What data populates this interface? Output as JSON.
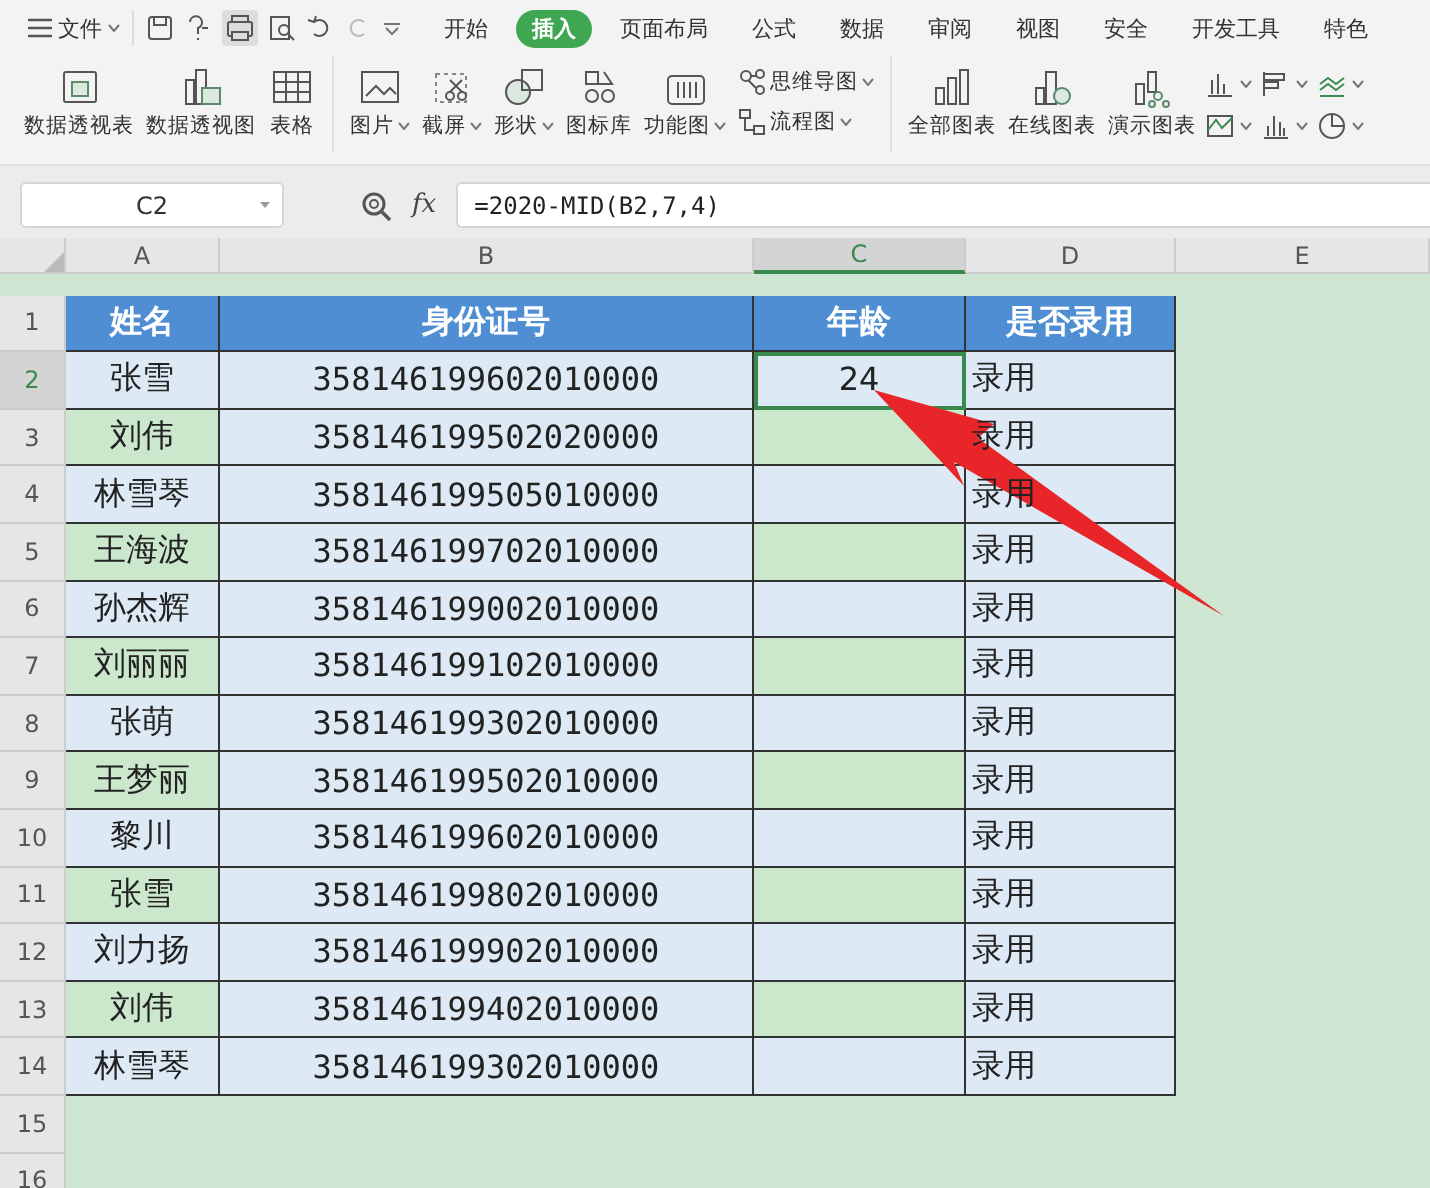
{
  "menu": {
    "file_label": "文件",
    "tabs": [
      {
        "label": "开始",
        "selected": false
      },
      {
        "label": "插入",
        "selected": true
      },
      {
        "label": "页面布局",
        "selected": false
      },
      {
        "label": "公式",
        "selected": false
      },
      {
        "label": "数据",
        "selected": false
      },
      {
        "label": "审阅",
        "selected": false
      },
      {
        "label": "视图",
        "selected": false
      },
      {
        "label": "安全",
        "selected": false
      },
      {
        "label": "开发工具",
        "selected": false
      },
      {
        "label": "特色",
        "selected": false
      }
    ]
  },
  "ribbon": {
    "groups": [
      [
        {
          "kind": "large",
          "label": "数据透视表",
          "dropdown": false
        },
        {
          "kind": "large",
          "label": "数据透视图",
          "dropdown": false
        },
        {
          "kind": "large",
          "label": "表格",
          "dropdown": false
        }
      ],
      [
        {
          "kind": "large",
          "label": "图片",
          "dropdown": true
        },
        {
          "kind": "large",
          "label": "截屏",
          "dropdown": true
        },
        {
          "kind": "large",
          "label": "形状",
          "dropdown": true
        },
        {
          "kind": "large",
          "label": "图标库",
          "dropdown": false
        },
        {
          "kind": "large",
          "label": "功能图",
          "dropdown": true
        },
        {
          "kind": "small",
          "label": "思维导图",
          "dropdown": true
        },
        {
          "kind": "small",
          "label": "流程图",
          "dropdown": true
        }
      ],
      [
        {
          "kind": "large",
          "label": "全部图表",
          "dropdown": false
        },
        {
          "kind": "large",
          "label": "在线图表",
          "dropdown": false
        },
        {
          "kind": "large",
          "label": "演示图表",
          "dropdown": false
        },
        {
          "kind": "mini",
          "dropdown": true
        },
        {
          "kind": "mini",
          "dropdown": true
        },
        {
          "kind": "mini",
          "dropdown": true
        },
        {
          "kind": "mini",
          "dropdown": true
        },
        {
          "kind": "mini",
          "dropdown": true
        },
        {
          "kind": "mini",
          "dropdown": true
        }
      ]
    ]
  },
  "formula_bar": {
    "name_box": "C2",
    "fx": "fx",
    "formula": "=2020-MID(B2,7,4)"
  },
  "sheet": {
    "columns": [
      {
        "label": "A",
        "selected": false
      },
      {
        "label": "B",
        "selected": false
      },
      {
        "label": "C",
        "selected": true
      },
      {
        "label": "D",
        "selected": false
      },
      {
        "label": "E",
        "selected": false
      }
    ],
    "rows": [
      {
        "number": "1",
        "selected": false,
        "header": true,
        "cells": [
          "姓名",
          "身份证号",
          "年龄",
          "是否录用"
        ]
      },
      {
        "number": "2",
        "selected": true,
        "header": false,
        "cells": [
          "张雪",
          "358146199602010000",
          "24",
          "录用"
        ]
      },
      {
        "number": "3",
        "selected": false,
        "header": false,
        "cells": [
          "刘伟",
          "358146199502020000",
          "",
          "录用"
        ]
      },
      {
        "number": "4",
        "selected": false,
        "header": false,
        "cells": [
          "林雪琴",
          "358146199505010000",
          "",
          "录用"
        ]
      },
      {
        "number": "5",
        "selected": false,
        "header": false,
        "cells": [
          "王海波",
          "358146199702010000",
          "",
          "录用"
        ]
      },
      {
        "number": "6",
        "selected": false,
        "header": false,
        "cells": [
          "孙杰辉",
          "358146199002010000",
          "",
          "录用"
        ]
      },
      {
        "number": "7",
        "selected": false,
        "header": false,
        "cells": [
          "刘丽丽",
          "358146199102010000",
          "",
          "录用"
        ]
      },
      {
        "number": "8",
        "selected": false,
        "header": false,
        "cells": [
          "张萌",
          "358146199302010000",
          "",
          "录用"
        ]
      },
      {
        "number": "9",
        "selected": false,
        "header": false,
        "cells": [
          "王梦丽",
          "358146199502010000",
          "",
          "录用"
        ]
      },
      {
        "number": "10",
        "selected": false,
        "header": false,
        "cells": [
          "黎川",
          "358146199602010000",
          "",
          "录用"
        ]
      },
      {
        "number": "11",
        "selected": false,
        "header": false,
        "cells": [
          "张雪",
          "358146199802010000",
          "",
          "录用"
        ]
      },
      {
        "number": "12",
        "selected": false,
        "header": false,
        "cells": [
          "刘力扬",
          "358146199902010000",
          "",
          "录用"
        ]
      },
      {
        "number": "13",
        "selected": false,
        "header": false,
        "cells": [
          "刘伟",
          "358146199402010000",
          "",
          "录用"
        ]
      },
      {
        "number": "14",
        "selected": false,
        "header": false,
        "cells": [
          "林雪琴",
          "358146199302010000",
          "",
          "录用"
        ]
      },
      {
        "number": "15",
        "selected": false,
        "cells": []
      },
      {
        "number": "16",
        "selected": false,
        "cells": []
      }
    ]
  }
}
